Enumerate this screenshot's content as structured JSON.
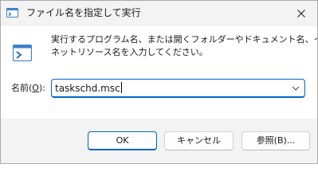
{
  "window": {
    "title": "ファイル名を指定して実行",
    "close_icon": "close-icon"
  },
  "main": {
    "description_line1": "実行するプログラム名、または開くフォルダーやドキュメント名、インター",
    "description_line2": "ネットリソース名を入力してください。",
    "open_label_prefix": "名前(",
    "open_label_key": "O",
    "open_label_suffix": "):",
    "open_value": "taskschd.msc"
  },
  "buttons": {
    "ok": "OK",
    "cancel": "キャンセル",
    "browse": "参照(B)..."
  },
  "colors": {
    "accent": "#0067c0"
  }
}
